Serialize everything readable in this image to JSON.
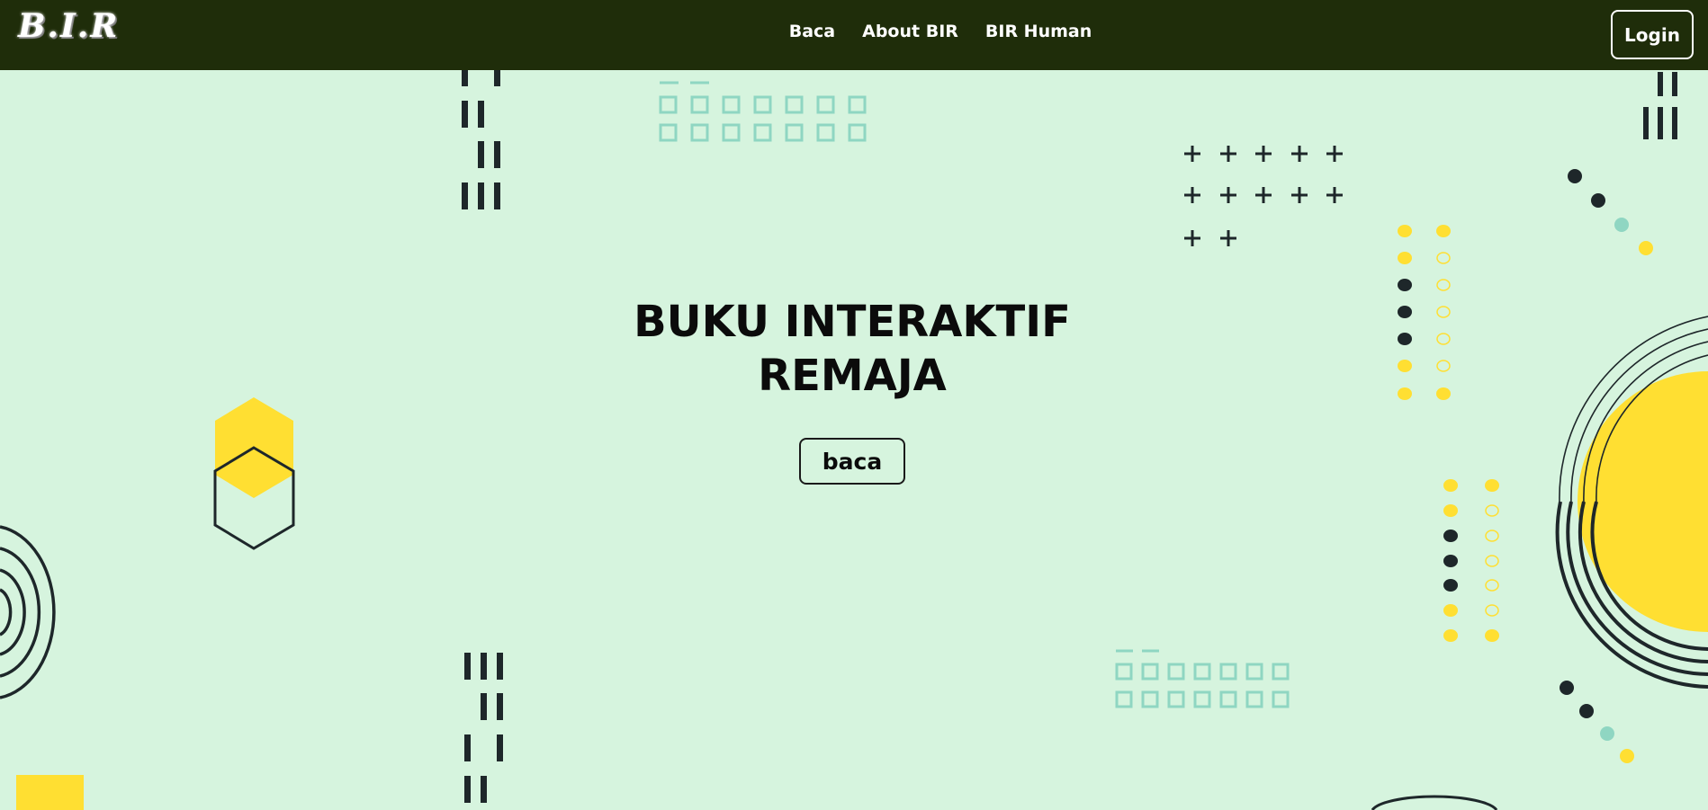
{
  "navbar": {
    "brand": "B.I.R",
    "links": [
      {
        "label": "Baca"
      },
      {
        "label": "About BIR"
      },
      {
        "label": "BIR Human"
      }
    ],
    "login_label": "Login"
  },
  "hero": {
    "title_line1": "BUKU INTERAKTIF",
    "title_line2": "REMAJA",
    "button_label": "baca"
  },
  "colors": {
    "background": "#d6f4de",
    "navbar": "#1f2d0a",
    "accent_yellow": "#ffdf32",
    "dark": "#1e272a",
    "teal": "#8fd6c2"
  }
}
